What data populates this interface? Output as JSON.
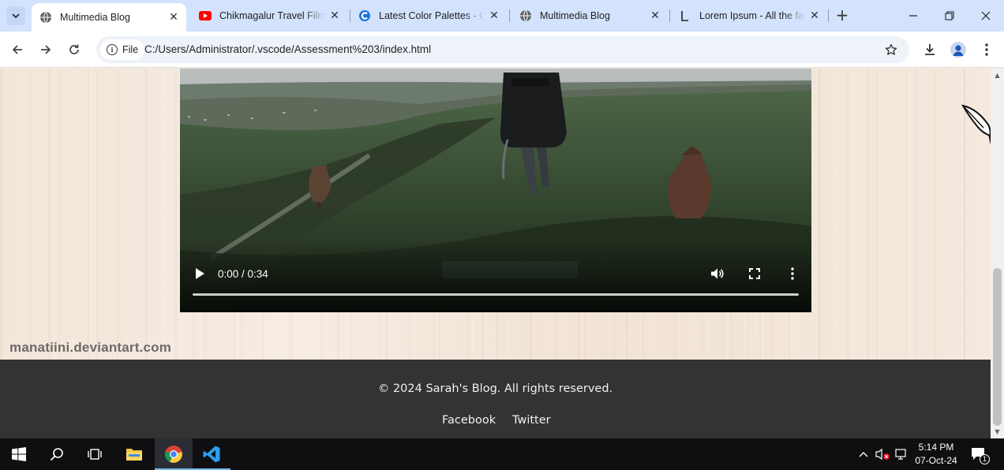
{
  "browser": {
    "tabs": [
      {
        "title": "Multimedia Blog",
        "favicon": "globe-icon",
        "active": true
      },
      {
        "title": "Chikmagalur Travel Film |",
        "favicon": "youtube-icon",
        "active": false
      },
      {
        "title": "Latest Color Palettes - Co",
        "favicon": "coolors-icon",
        "active": false
      },
      {
        "title": "Multimedia Blog",
        "favicon": "globe-icon",
        "active": false
      },
      {
        "title": "Lorem Ipsum - All the fac",
        "favicon": "lipsum-icon",
        "active": false
      }
    ],
    "address": {
      "chip_label": "File",
      "url": "C:/Users/Administrator/.vscode/Assessment%203/index.html"
    },
    "colors": {
      "tabstrip": "#d3e3fd",
      "omnibox": "#eef2f9"
    }
  },
  "page": {
    "video": {
      "time": "0:00 / 0:34",
      "progress": 0
    },
    "watermark": "manatiini.deviantart.com",
    "footer": {
      "copyright": "© 2024 Sarah's Blog. All rights reserved.",
      "links": [
        "Facebook",
        "Twitter"
      ]
    },
    "colors": {
      "footer_bg": "#333333",
      "footer_text": "#f0f0f0"
    }
  },
  "taskbar": {
    "apps": [
      "start-icon",
      "search-icon",
      "task-view-icon",
      "file-explorer-icon",
      "chrome-icon",
      "vscode-icon"
    ],
    "clock": {
      "time": "5:14 PM",
      "date": "07-Oct-24"
    },
    "notification_count": "1"
  }
}
